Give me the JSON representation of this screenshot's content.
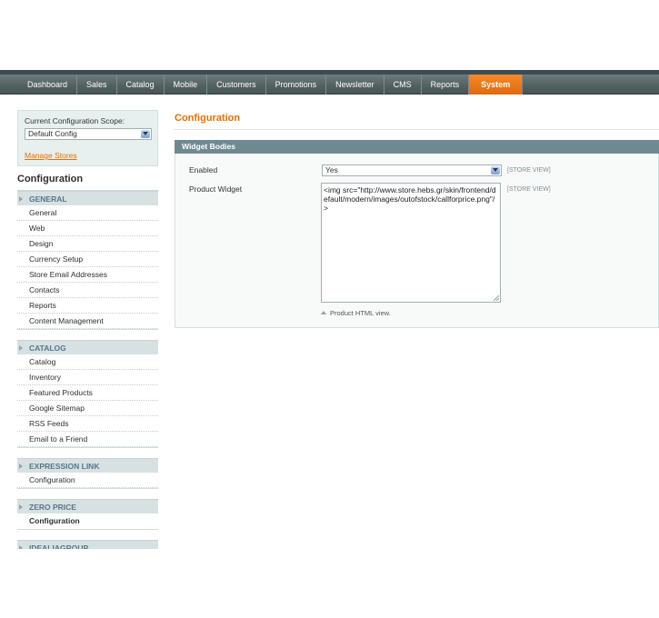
{
  "nav": {
    "items": [
      "Dashboard",
      "Sales",
      "Catalog",
      "Mobile",
      "Customers",
      "Promotions",
      "Newsletter",
      "CMS",
      "Reports",
      "System"
    ],
    "active": "System"
  },
  "scope": {
    "label": "Current Configuration Scope:",
    "selected": "Default Config",
    "manage_link": "Manage Stores"
  },
  "sidebar": {
    "title": "Configuration",
    "sections": [
      {
        "title": "GENERAL",
        "items": [
          "General",
          "Web",
          "Design",
          "Currency Setup",
          "Store Email Addresses",
          "Contacts",
          "Reports",
          "Content Management"
        ]
      },
      {
        "title": "CATALOG",
        "items": [
          "Catalog",
          "Inventory",
          "Featured Products",
          "Google Sitemap",
          "RSS Feeds",
          "Email to a Friend"
        ]
      },
      {
        "title": "EXPRESSION LINK",
        "items": [
          "Configuration"
        ]
      },
      {
        "title": "ZERO PRICE",
        "items": [
          "Configuration"
        ],
        "active_item": "Configuration"
      },
      {
        "title": "IDEALIAGROUP",
        "items": []
      }
    ]
  },
  "main": {
    "title": "Configuration",
    "panel_title": "Widget Bodies",
    "enabled_label": "Enabled",
    "enabled_value": "Yes",
    "widget_label": "Product Widget",
    "widget_value": "<img src=\"http://www.store.hebs.gr/skin/frontend/default/modern/images/outofstock/callforprice.png\"/>",
    "scope_tag": "[STORE VIEW]",
    "note": "Product HTML view."
  },
  "colors": {
    "accent": "#e86f00",
    "nav_bg": "#52605f",
    "panel_head": "#6f8992",
    "sidebar_bg": "#e8efef"
  }
}
